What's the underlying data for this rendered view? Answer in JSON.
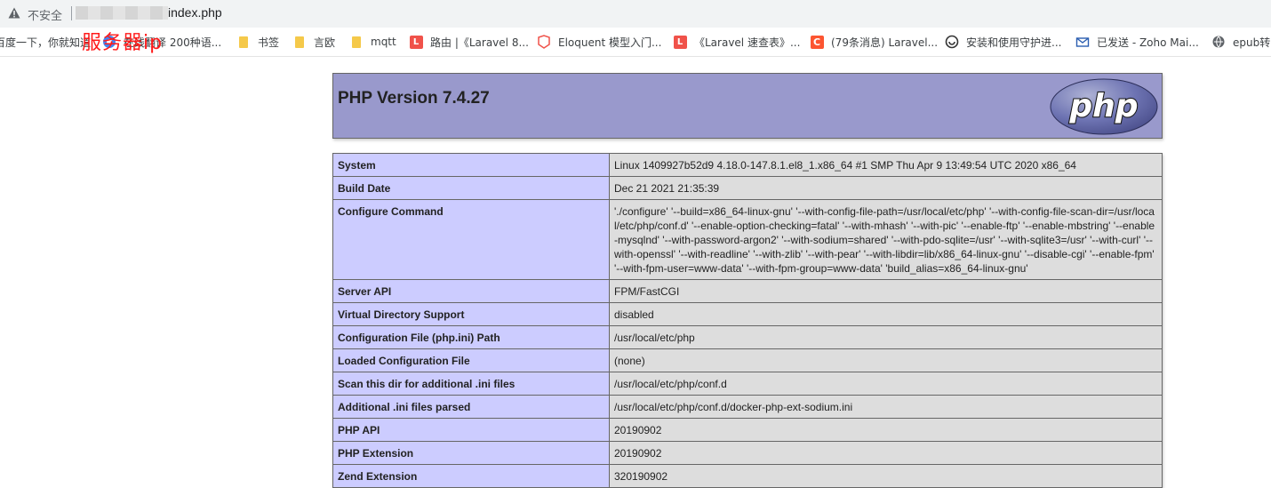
{
  "browser": {
    "insecure_label": "不安全",
    "url_path": "index.php",
    "overlay_annotation": "服务器ip"
  },
  "bookmarks": [
    {
      "label": "百度一下，你就知道",
      "icon": "baidu-icon"
    },
    {
      "label": "在线翻译 200种语...",
      "icon": "translate-icon"
    },
    {
      "label": "书签",
      "icon": "folder-icon"
    },
    {
      "label": "言欧",
      "icon": "folder-icon"
    },
    {
      "label": "mqtt",
      "icon": "folder-icon"
    },
    {
      "label": "路由 |《Laravel 8...",
      "icon": "laravel-icon"
    },
    {
      "label": "Eloquent 模型入门...",
      "icon": "laravel-icon"
    },
    {
      "label": "《Laravel 速查表》...",
      "icon": "laravel-icon"
    },
    {
      "label": "(79条消息) Laravel...",
      "icon": "csdn-icon"
    },
    {
      "label": "安装和使用守护进...",
      "icon": "globe-icon"
    },
    {
      "label": "已发送 - Zoho Mai...",
      "icon": "mail-icon"
    },
    {
      "label": "epub转",
      "icon": "globe-icon"
    }
  ],
  "php": {
    "title": "PHP Version 7.4.27",
    "logo_text": "php",
    "rows": [
      {
        "key": "System",
        "value": "Linux 1409927b52d9 4.18.0-147.8.1.el8_1.x86_64 #1 SMP Thu Apr 9 13:49:54 UTC 2020 x86_64"
      },
      {
        "key": "Build Date",
        "value": "Dec 21 2021 21:35:39"
      },
      {
        "key": "Configure Command",
        "value": "'./configure' '--build=x86_64-linux-gnu' '--with-config-file-path=/usr/local/etc/php' '--with-config-file-scan-dir=/usr/local/etc/php/conf.d' '--enable-option-checking=fatal' '--with-mhash' '--with-pic' '--enable-ftp' '--enable-mbstring' '--enable-mysqlnd' '--with-password-argon2' '--with-sodium=shared' '--with-pdo-sqlite=/usr' '--with-sqlite3=/usr' '--with-curl' '--with-openssl' '--with-readline' '--with-zlib' '--with-pear' '--with-libdir=lib/x86_64-linux-gnu' '--disable-cgi' '--enable-fpm' '--with-fpm-user=www-data' '--with-fpm-group=www-data' 'build_alias=x86_64-linux-gnu'"
      },
      {
        "key": "Server API",
        "value": "FPM/FastCGI"
      },
      {
        "key": "Virtual Directory Support",
        "value": "disabled"
      },
      {
        "key": "Configuration File (php.ini) Path",
        "value": "/usr/local/etc/php"
      },
      {
        "key": "Loaded Configuration File",
        "value": "(none)"
      },
      {
        "key": "Scan this dir for additional .ini files",
        "value": "/usr/local/etc/php/conf.d"
      },
      {
        "key": "Additional .ini files parsed",
        "value": "/usr/local/etc/php/conf.d/docker-php-ext-sodium.ini"
      },
      {
        "key": "PHP API",
        "value": "20190902"
      },
      {
        "key": "PHP Extension",
        "value": "20190902"
      },
      {
        "key": "Zend Extension",
        "value": "320190902"
      }
    ]
  }
}
